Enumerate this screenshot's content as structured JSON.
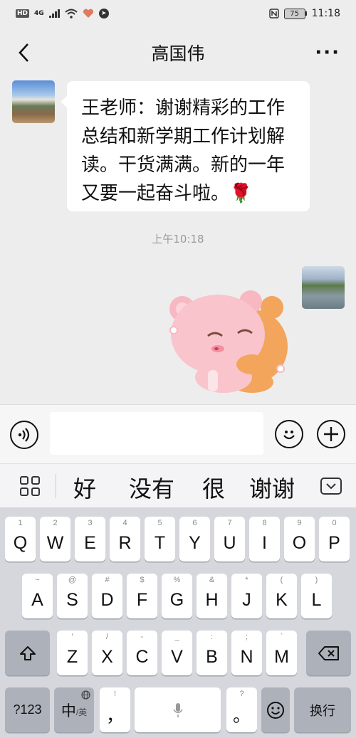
{
  "status_bar": {
    "hd_badge": "HD",
    "network": "4G",
    "battery_level": "75",
    "time": "11:18"
  },
  "nav": {
    "title": "高国伟"
  },
  "chat": {
    "messages": [
      {
        "sender": "incoming",
        "text": "王老师：谢谢精彩的工作总结和新学期工作计划解读。干货满满。新的一年又要一起奋斗啦。🌹"
      }
    ],
    "timestamp": "上午10:18",
    "sticker": "bear-hug-sticker"
  },
  "input_bar": {
    "value": "",
    "placeholder": ""
  },
  "candidates": [
    "好",
    "没有",
    "很",
    "谢谢"
  ],
  "keyboard": {
    "row1": [
      {
        "sub": "1",
        "key": "Q"
      },
      {
        "sub": "2",
        "key": "W"
      },
      {
        "sub": "3",
        "key": "E"
      },
      {
        "sub": "4",
        "key": "R"
      },
      {
        "sub": "5",
        "key": "T"
      },
      {
        "sub": "6",
        "key": "Y"
      },
      {
        "sub": "7",
        "key": "U"
      },
      {
        "sub": "8",
        "key": "I"
      },
      {
        "sub": "9",
        "key": "O"
      },
      {
        "sub": "0",
        "key": "P"
      }
    ],
    "row2": [
      {
        "sub": "~",
        "key": "A"
      },
      {
        "sub": "@",
        "key": "S"
      },
      {
        "sub": "#",
        "key": "D"
      },
      {
        "sub": "$",
        "key": "F"
      },
      {
        "sub": "%",
        "key": "G"
      },
      {
        "sub": "&",
        "key": "H"
      },
      {
        "sub": "*",
        "key": "J"
      },
      {
        "sub": "(",
        "key": "K"
      },
      {
        "sub": ")",
        "key": "L"
      }
    ],
    "row3": [
      {
        "sub": "'",
        "key": "Z"
      },
      {
        "sub": "/",
        "key": "X"
      },
      {
        "sub": "-",
        "key": "C"
      },
      {
        "sub": "_",
        "key": "V"
      },
      {
        "sub": ":",
        "key": "B"
      },
      {
        "sub": ";",
        "key": "N"
      },
      {
        "sub": "`",
        "key": "M"
      }
    ],
    "symbols_label": "?123",
    "lang_label_main": "中",
    "lang_label_alt": "/英",
    "comma_sub": "!",
    "comma_key": "，",
    "period_sub": "?",
    "period_key": "。",
    "enter_label": "换行"
  }
}
